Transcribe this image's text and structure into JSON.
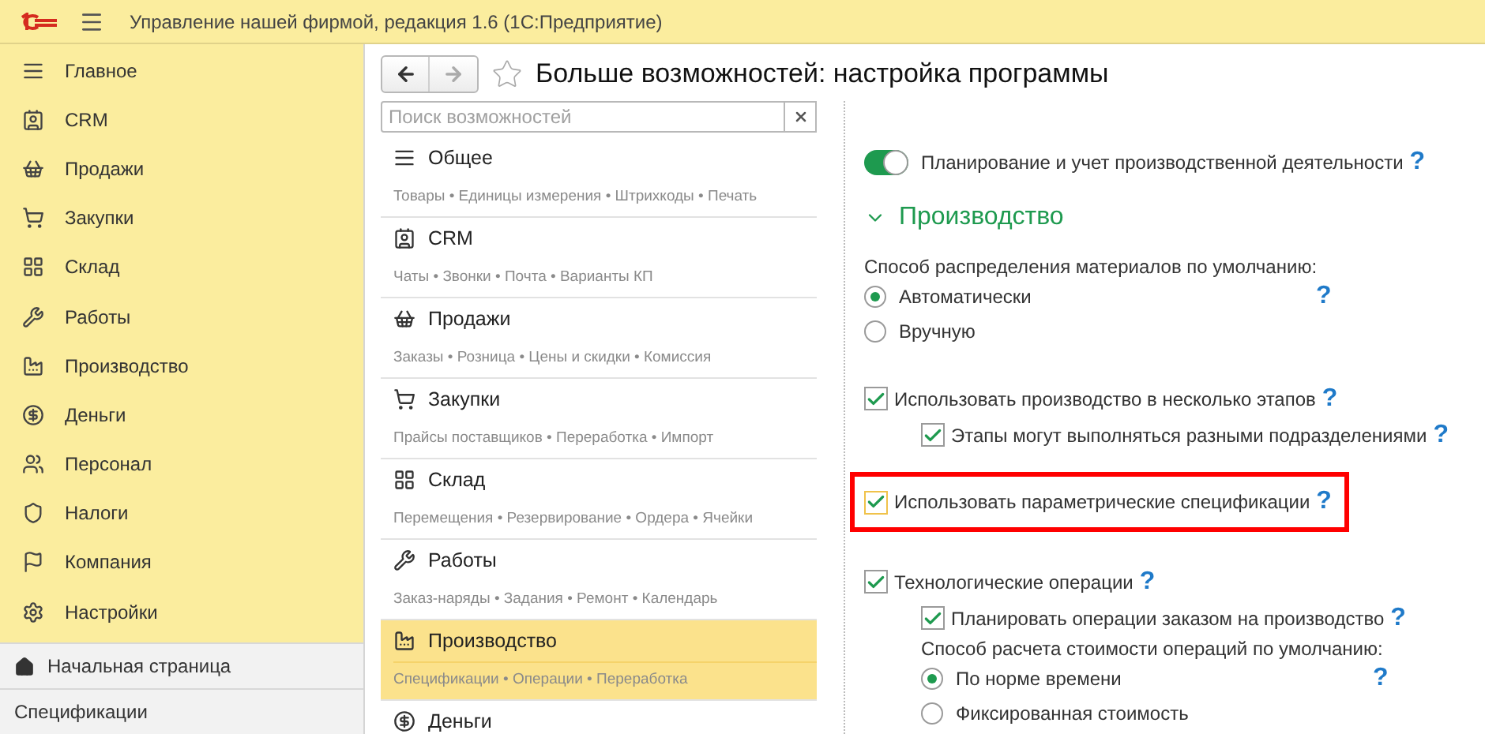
{
  "app_title": "Управление нашей фирмой, редакция 1.6  (1С:Предприятие)",
  "sidebar": {
    "items": [
      {
        "label": "Главное"
      },
      {
        "label": "CRM"
      },
      {
        "label": "Продажи"
      },
      {
        "label": "Закупки"
      },
      {
        "label": "Склад"
      },
      {
        "label": "Работы"
      },
      {
        "label": "Производство"
      },
      {
        "label": "Деньги"
      },
      {
        "label": "Персонал"
      },
      {
        "label": "Налоги"
      },
      {
        "label": "Компания"
      },
      {
        "label": "Настройки"
      }
    ],
    "bottom": [
      {
        "label": "Начальная страница",
        "kind": "home"
      },
      {
        "label": "Спецификации",
        "kind": "tab"
      }
    ]
  },
  "page_title": "Больше возможностей: настройка программы",
  "search": {
    "placeholder": "Поиск возможностей"
  },
  "categories": [
    {
      "title": "Общее",
      "subtitle": "Товары • Единицы измерения • Штрихкоды • Печать",
      "selected": false
    },
    {
      "title": "CRM",
      "subtitle": "Чаты • Звонки • Почта • Варианты КП",
      "selected": false
    },
    {
      "title": "Продажи",
      "subtitle": "Заказы • Розница • Цены и скидки • Комиссия",
      "selected": false
    },
    {
      "title": "Закупки",
      "subtitle": "Прайсы поставщиков • Переработка • Импорт",
      "selected": false
    },
    {
      "title": "Склад",
      "subtitle": "Перемещения • Резервирование • Ордера • Ячейки",
      "selected": false
    },
    {
      "title": "Работы",
      "subtitle": "Заказ-наряды • Задания • Ремонт • Календарь",
      "selected": false
    },
    {
      "title": "Производство",
      "subtitle": "Спецификации • Операции • Переработка",
      "selected": true
    },
    {
      "title": "Деньги",
      "selected": false
    }
  ],
  "settings": [
    {
      "kind": "toggle",
      "label": "Планирование и учет производственной деятельности",
      "on": true,
      "help": "?"
    },
    {
      "kind": "section",
      "label": "Производство",
      "expanded": true
    },
    {
      "kind": "label",
      "label": "Способ распределения материалов по умолчанию:"
    },
    {
      "kind": "radio",
      "label": "Автоматически",
      "selected": true,
      "help": "?"
    },
    {
      "kind": "radio",
      "label": "Вручную",
      "selected": false
    },
    {
      "kind": "checkbox",
      "label": "Использовать производство в несколько этапов",
      "checked": true,
      "help": "?",
      "children": [
        {
          "kind": "checkbox",
          "label": "Этапы могут выполняться разными подразделениями",
          "checked": true,
          "help": "?"
        }
      ]
    },
    {
      "kind": "checkbox",
      "label": "Использовать параметрические спецификации",
      "checked": true,
      "help": "?",
      "highlighted": true,
      "focused": true
    },
    {
      "kind": "checkbox",
      "label": "Технологические операции",
      "checked": true,
      "help": "?",
      "children": [
        {
          "kind": "checkbox",
          "label": "Планировать операции заказом на производство",
          "checked": true,
          "help": "?"
        },
        {
          "kind": "label",
          "label": "Способ расчета стоимости операций по умолчанию:"
        },
        {
          "kind": "radio",
          "label": "По норме времени",
          "selected": true,
          "help": "?"
        },
        {
          "kind": "radio",
          "label": "Фиксированная стоимость",
          "selected": false
        }
      ]
    }
  ]
}
